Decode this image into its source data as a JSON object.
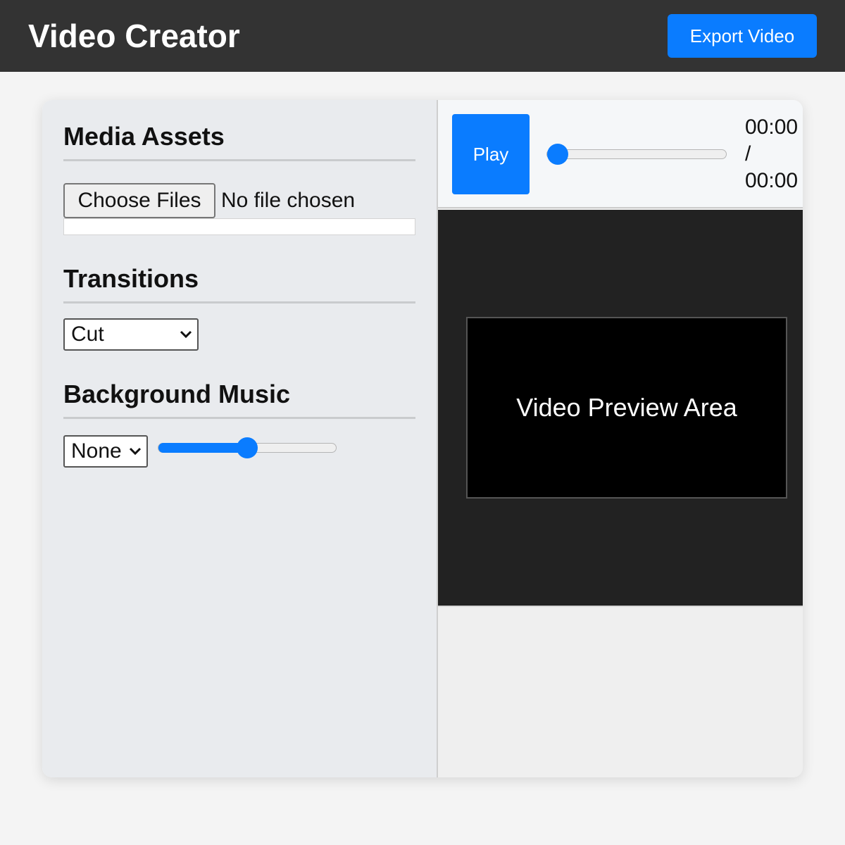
{
  "header": {
    "title": "Video Creator",
    "export_label": "Export Video"
  },
  "sidebar": {
    "media": {
      "title": "Media Assets",
      "file_button_label": "Choose Files",
      "file_status": "No file chosen"
    },
    "transitions": {
      "title": "Transitions",
      "selected": "Cut"
    },
    "music": {
      "title": "Background Music",
      "selected": "None",
      "volume_fraction": 0.5
    }
  },
  "player": {
    "play_label": "Play",
    "current_time": "00:00",
    "separator": "/",
    "duration": "00:00",
    "seek_fraction": 0.0,
    "preview_text": "Video Preview Area"
  },
  "colors": {
    "accent": "#0a7cff",
    "topbar": "#333333",
    "preview_stage": "#222222"
  },
  "icons": [
    "chevron-down-icon"
  ]
}
